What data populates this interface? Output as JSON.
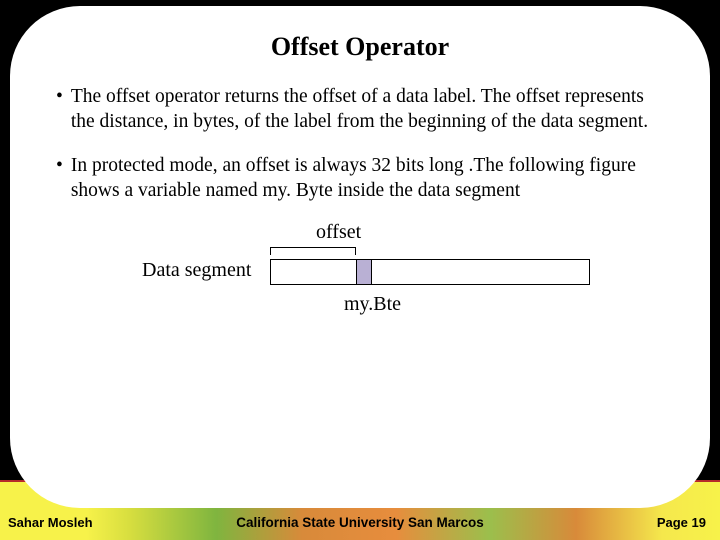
{
  "title": "Offset Operator",
  "bullets": [
    "The offset operator returns the offset of a data label. The offset represents the distance, in bytes, of the label from the beginning of the data segment.",
    "In protected mode, an offset is always 32 bits long .The following figure shows a variable named my. Byte inside the data segment"
  ],
  "diagram": {
    "offset_label": "offset",
    "segment_label": "Data segment",
    "variable_label": "my.Bte"
  },
  "footer": {
    "left": "Sahar Mosleh",
    "center": "California State University San Marcos",
    "right_prefix": "Page ",
    "page_number": "19"
  }
}
